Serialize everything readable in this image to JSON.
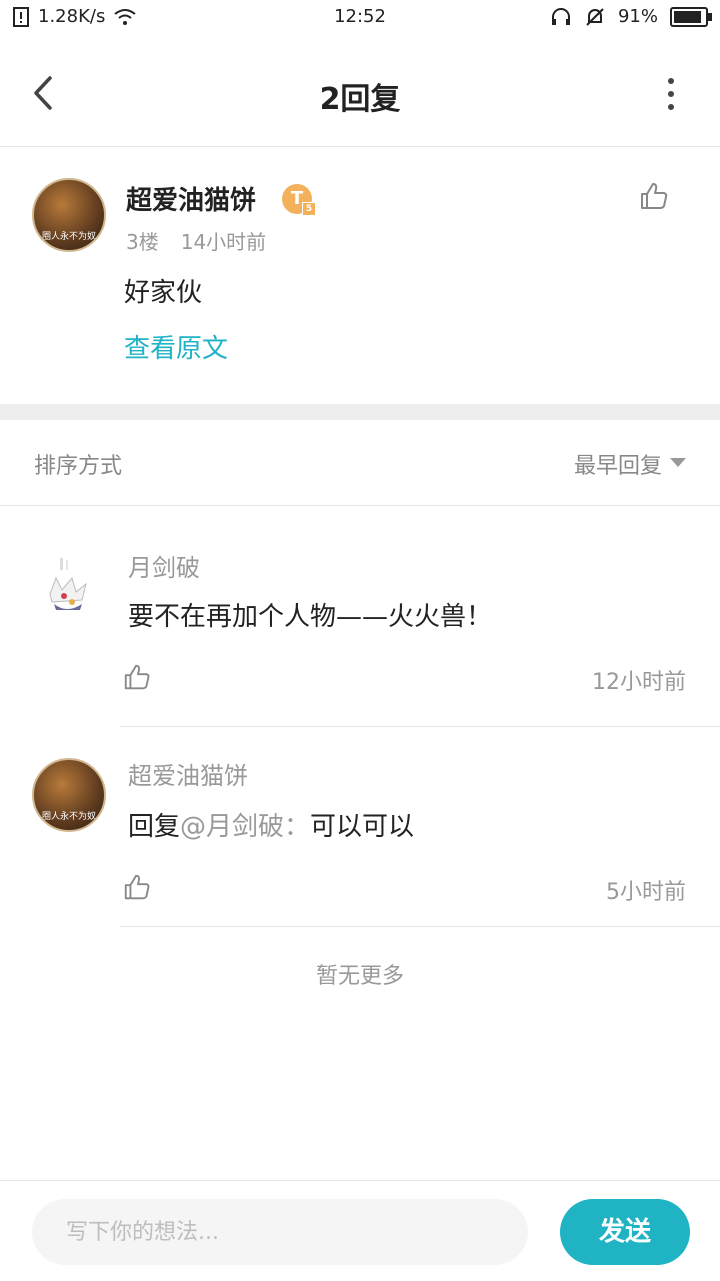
{
  "status": {
    "network_speed": "1.28K/s",
    "time": "12:52",
    "battery": "91%",
    "battery_fraction": 0.91
  },
  "header": {
    "title": "2回复",
    "back_icon": "chevron-left-icon",
    "more_icon": "more-vertical-icon"
  },
  "original_post": {
    "author": "超爱油猫饼",
    "badge_letter": "T",
    "badge_level": "5",
    "floor": "3楼",
    "time": "14小时前",
    "content": "好家伙",
    "view_original": "查看原文",
    "avatar_caption": "圈人永不为奴"
  },
  "sort": {
    "label": "排序方式",
    "value": "最早回复"
  },
  "replies": [
    {
      "author": "月剑破",
      "content": "要不在再加个人物——火火兽！",
      "time": "12小时前"
    },
    {
      "author": "超爱油猫饼",
      "reply_prefix": "回复",
      "mention": "@月剑破",
      "separator": "：",
      "content": "可以可以",
      "time": "5小时前",
      "avatar_caption": "圈人永不为奴"
    }
  ],
  "footer_note": "暂无更多",
  "composer": {
    "placeholder": "写下你的想法...",
    "send_label": "发送"
  },
  "colors": {
    "accent": "#1fb3c4",
    "link": "#20b2c6"
  }
}
